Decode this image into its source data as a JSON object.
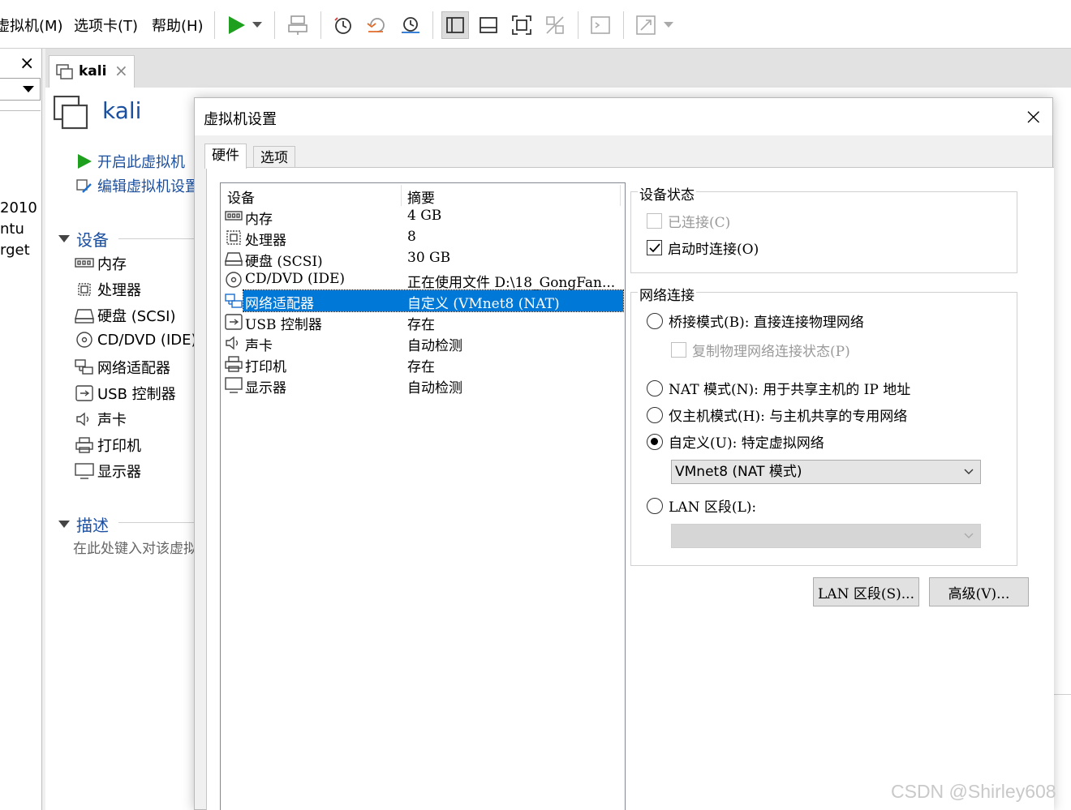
{
  "menubar": {
    "items": [
      "虚拟机(M)",
      "选项卡(T)",
      "帮助(H)"
    ]
  },
  "sidebar": {
    "close_glyph": "×",
    "partial_texts": [
      "2010",
      "ntu",
      "rget"
    ]
  },
  "tabs": {
    "vm_tab_label": "kali",
    "close_glyph": "×"
  },
  "vm": {
    "title": "kali",
    "actions": [
      "开启此虚拟机",
      "编辑虚拟机设置"
    ],
    "devices_header": "设备",
    "devices": [
      "内存",
      "处理器",
      "硬盘 (SCSI)",
      "CD/DVD (IDE)",
      "网络适配器",
      "USB 控制器",
      "声卡",
      "打印机",
      "显示器"
    ],
    "description_header": "描述",
    "description_placeholder": "在此处键入对该虚拟"
  },
  "dialog": {
    "title": "虚拟机设置",
    "close_glyph": "×",
    "tabs": [
      "硬件",
      "选项"
    ],
    "list_headers": {
      "device": "设备",
      "summary": "摘要"
    },
    "hardware": [
      {
        "name": "内存",
        "summary": "4 GB",
        "icon": "memory-icon"
      },
      {
        "name": "处理器",
        "summary": "8",
        "icon": "cpu-icon"
      },
      {
        "name": "硬盘 (SCSI)",
        "summary": "30 GB",
        "icon": "hdd-icon"
      },
      {
        "name": "CD/DVD (IDE)",
        "summary": "正在使用文件 D:\\18_GongFan...",
        "icon": "cdrom-icon"
      },
      {
        "name": "网络适配器",
        "summary": "自定义 (VMnet8 (NAT)",
        "icon": "network-icon",
        "selected": true
      },
      {
        "name": "USB 控制器",
        "summary": "存在",
        "icon": "usb-icon"
      },
      {
        "name": "声卡",
        "summary": "自动检测",
        "icon": "speaker-icon"
      },
      {
        "name": "打印机",
        "summary": "存在",
        "icon": "printer-icon"
      },
      {
        "name": "显示器",
        "summary": "自动检测",
        "icon": "monitor-icon"
      }
    ],
    "device_status": {
      "label": "设备状态",
      "connected": "已连接(C)",
      "connect_at_power_on": "启动时连接(O)"
    },
    "network": {
      "label": "网络连接",
      "bridged": "桥接模式(B): 直接连接物理网络",
      "replicate": "复制物理网络连接状态(P)",
      "nat": "NAT 模式(N): 用于共享主机的 IP 地址",
      "host_only": "仅主机模式(H): 与主机共享的专用网络",
      "custom": "自定义(U): 特定虚拟网络",
      "custom_value": "VMnet8 (NAT 模式)",
      "lan": "LAN 区段(L):",
      "lan_value": ""
    },
    "buttons": {
      "lan_segments": "LAN 区段(S)...",
      "advanced": "高级(V)..."
    }
  },
  "watermark": "CSDN @Shirley608",
  "colors": {
    "selection": "#0078d7",
    "play_green": "#1ea01e",
    "link_blue": "#1b4fa0"
  }
}
